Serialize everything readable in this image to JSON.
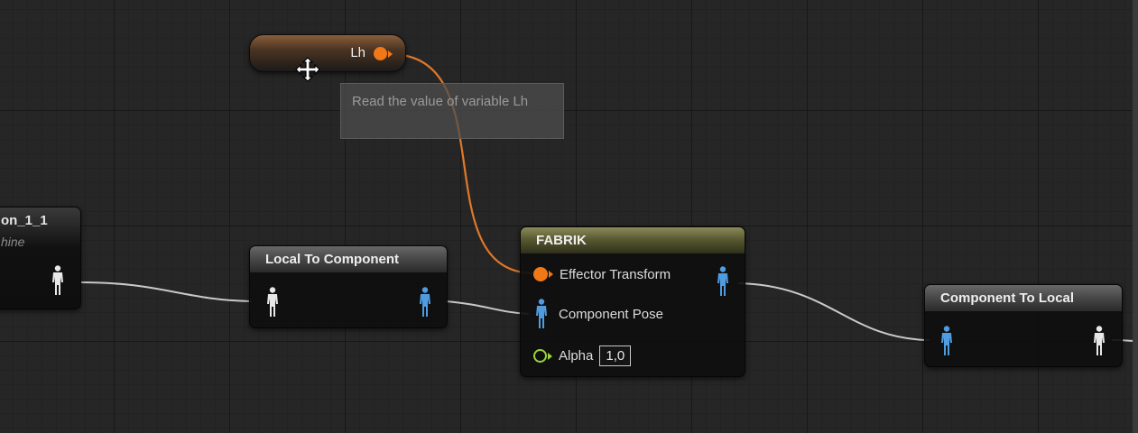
{
  "variable_node": {
    "label": "Lh",
    "tooltip": "Read the value of variable Lh",
    "pin_color": "#f07817"
  },
  "left_node": {
    "title": "on_1_1",
    "subtitle": "hine"
  },
  "local_to_component": {
    "title": "Local To Component"
  },
  "fabrik": {
    "title": "FABRIK",
    "pins": {
      "effector_transform": "Effector Transform",
      "component_pose": "Component Pose",
      "alpha": "Alpha"
    },
    "alpha_value": "1,0"
  },
  "component_to_local": {
    "title": "Component To Local"
  },
  "colors": {
    "transform_pin": "#f07817",
    "pose_pin_blue": "#4f9de0",
    "pose_pin_white": "#e8e8e8",
    "float_pin": "#9bd43a",
    "wire_exec": "#d0d0d0",
    "wire_transform": "#e0782a"
  },
  "icons": [
    "move-cursor-icon",
    "pose-pin-icon",
    "transform-pin-icon",
    "float-pin-icon"
  ]
}
